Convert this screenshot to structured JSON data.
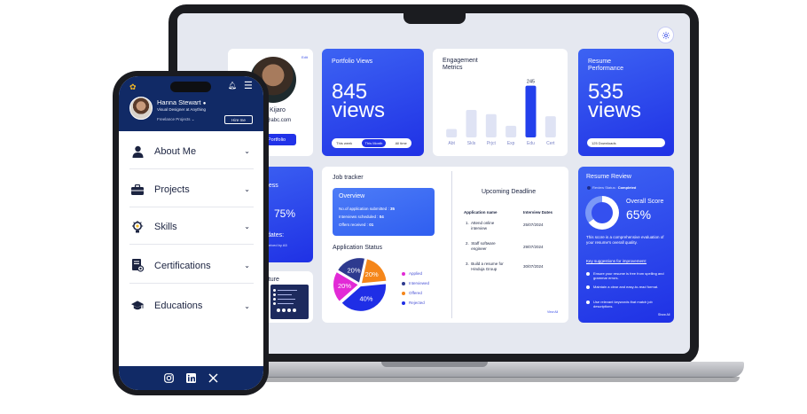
{
  "dashboard": {
    "profile": {
      "edit_label": "Edit",
      "name_fragment": "Kijaro",
      "email_fragment": "o@abc.com",
      "portfolio_button": "Portfolio"
    },
    "portfolio_views": {
      "title": "Portfolio Views",
      "value": "845",
      "unit": "views",
      "tabs": [
        "This week",
        "This Month",
        "All time"
      ],
      "active_tab": 1
    },
    "engagement": {
      "title_line1": "Engagement",
      "title_line2": "Metrics",
      "highlight_value": "245",
      "chart_data": {
        "type": "bar",
        "categories": [
          "Abt",
          "Skls",
          "Prjct",
          "Exp",
          "Edu",
          "Cert"
        ],
        "values": [
          40,
          130,
          110,
          55,
          245,
          100
        ],
        "highlight_index": 4,
        "ylim": [
          0,
          260
        ],
        "color": "#dfe3f4",
        "highlight_color": "#2340ec"
      }
    },
    "resume_performance": {
      "title_line1": "Resume",
      "title_line2": "Performance",
      "value": "535",
      "unit": "views",
      "pill": "125 Downloads"
    },
    "left_blue": {
      "title_fragment": "ness",
      "percent": "75%",
      "dates_fragment": "dates:",
      "sub_fragment": "ceived by A5"
    },
    "signature": {
      "title_fragment": "nature"
    },
    "job_tracker": {
      "title": "Job tracker",
      "overview_title": "Overview",
      "overview_lines": [
        {
          "label": "No.of application submitted : ",
          "value": "35"
        },
        {
          "label": "Interviews scheduled : ",
          "value": "04"
        },
        {
          "label": "Offers received : ",
          "value": "01"
        }
      ],
      "status_title": "Application Status",
      "pie": [
        {
          "name": "Applied",
          "value": 20,
          "label": "20%",
          "color": "#e22ad6"
        },
        {
          "name": "Interviewed",
          "value": 20,
          "label": "20%",
          "color": "#2e3a8f"
        },
        {
          "name": "Offered",
          "value": 20,
          "label": "20%",
          "color": "#f5861a"
        },
        {
          "name": "Rejected",
          "value": 40,
          "label": "40%",
          "color": "#1f2ee6"
        }
      ],
      "legend": [
        "Applied",
        "Interviewed",
        "Offered",
        "Rejected"
      ],
      "deadline_title": "Upcoming Deadline",
      "col_app": "Application name",
      "col_date": "Interview Dates",
      "rows": [
        {
          "name": "1.  Attend online\n     interview",
          "date": "25/07/2024"
        },
        {
          "name": "2.  Staff software\n     engineer",
          "date": "29/07/2024"
        },
        {
          "name": "3.  Build a resume for\n     Hinduja Group",
          "date": "30/07/2024"
        }
      ],
      "view_all": "View All"
    },
    "resume_review": {
      "title": "Resume Review",
      "status_label": "Review Status:",
      "status_value": "Completed",
      "overall_label": "Overall Score",
      "overall_value": "65%",
      "score_fraction": 0.65,
      "desc": "This score is a comprehensive evaluation of your resume's overall quality.",
      "key_title": "Key suggestions for improvement:",
      "bullets": [
        "Ensure your resume is free from spelling and grammar errors.",
        "Maintain a clear and easy-to-read format.",
        "Use relevant keywords that match job descriptions."
      ],
      "more": "Show All"
    }
  },
  "phone": {
    "name": "Hanna Stewart",
    "title": "Visual Designer at Anything",
    "freelance": "Freelance Projects",
    "hire_button": "Hire me",
    "menu": [
      {
        "label": "About Me",
        "icon": "person-icon"
      },
      {
        "label": "Projects",
        "icon": "briefcase-icon"
      },
      {
        "label": "Skills",
        "icon": "lightbulb-gear-icon"
      },
      {
        "label": "Certifications",
        "icon": "certificate-icon"
      },
      {
        "label": "Educations",
        "icon": "graduation-cap-icon"
      }
    ],
    "footer_icons": [
      "instagram-icon",
      "linkedin-icon",
      "x-icon"
    ]
  }
}
